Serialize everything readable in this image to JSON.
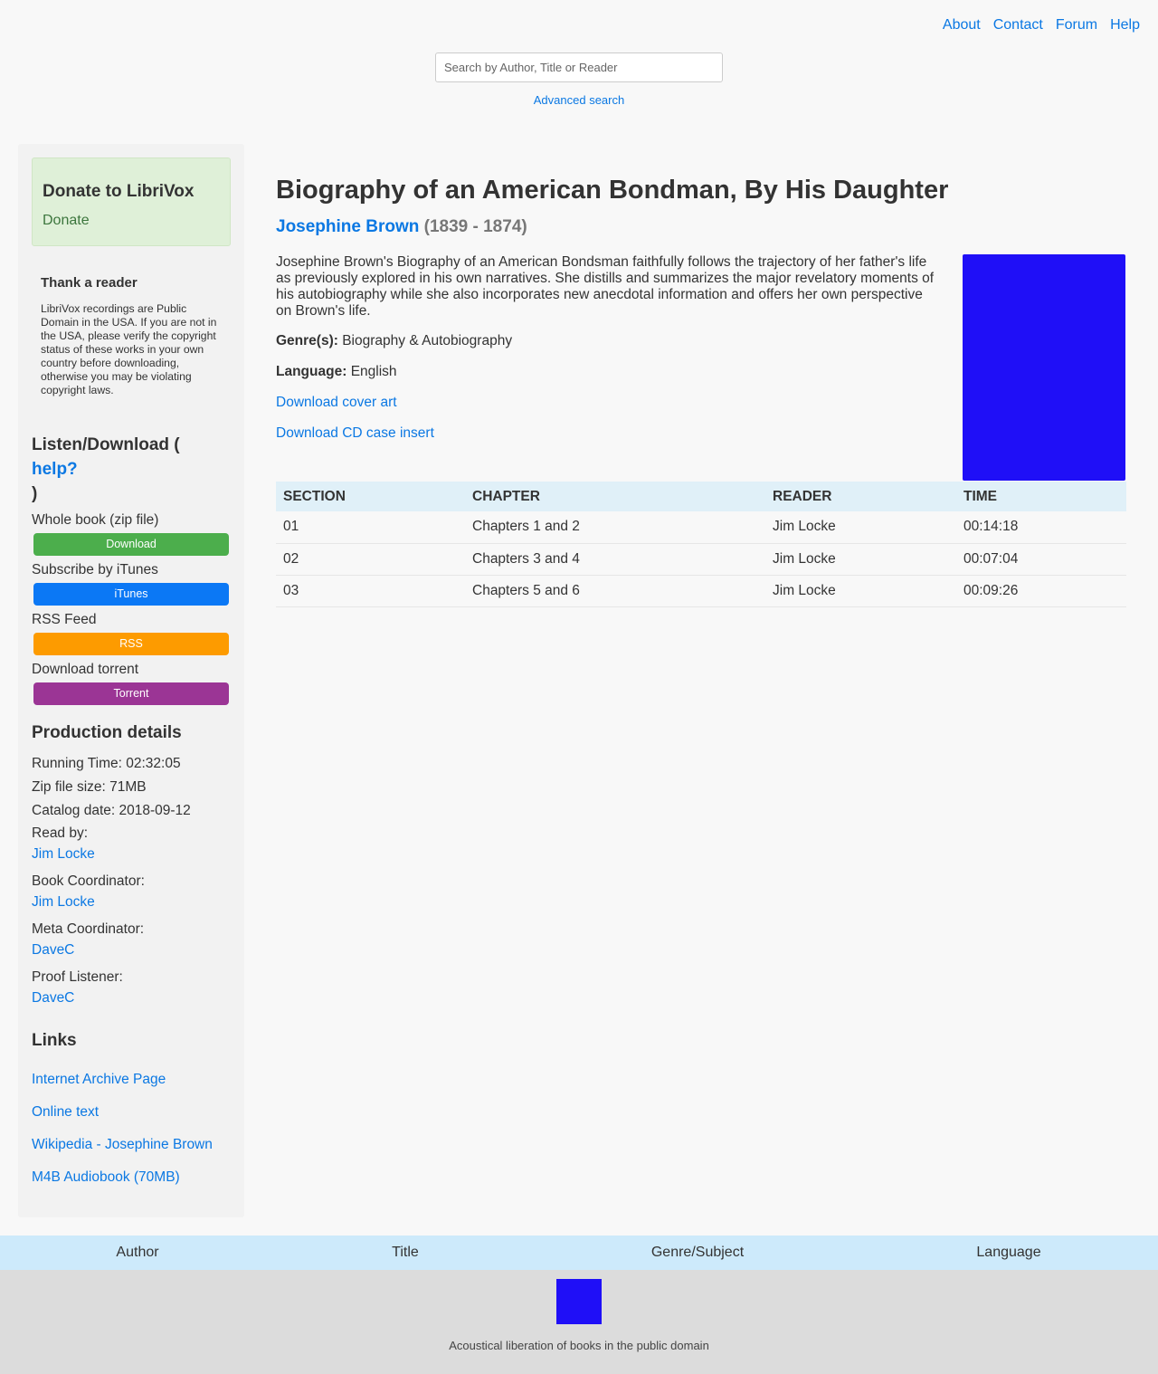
{
  "nav": {
    "about": "About",
    "contact": "Contact",
    "forum": "Forum",
    "help": "Help"
  },
  "search": {
    "placeholder": "Search by Author, Title or Reader",
    "advanced": "Advanced search"
  },
  "sidebar": {
    "donate_title": "Donate to LibriVox",
    "donate_link": "Donate",
    "thank_title": "Thank a reader",
    "thank_text": "LibriVox recordings are Public Domain in the USA. If you are not in the USA, please verify the copyright status of these works in your own country before downloading, otherwise you may be violating copyright laws.",
    "listen_title_pre": "Listen/Download (",
    "listen_help": "help?",
    "listen_title_post": ")",
    "downloads": [
      {
        "label": "Whole book (zip file)",
        "button": "Download",
        "color": "#4cae4c"
      },
      {
        "label": "Subscribe by iTunes",
        "button": "iTunes",
        "color": "#0b78f5"
      },
      {
        "label": "RSS Feed",
        "button": "RSS",
        "color": "#fd9b00"
      },
      {
        "label": "Download torrent",
        "button": "Torrent",
        "color": "#9b3595"
      }
    ],
    "production": {
      "title": "Production details",
      "running_time": "Running Time: 02:32:05",
      "zip_size": "Zip file size: 71MB",
      "catalog_date": "Catalog date: 2018-09-12",
      "read_by_label": "Read by:",
      "read_by": "Jim Locke",
      "book_coord_label": "Book Coordinator:",
      "book_coord": "Jim Locke",
      "meta_coord_label": "Meta Coordinator:",
      "meta_coord": "DaveC",
      "proof_label": "Proof Listener:",
      "proof": "DaveC"
    },
    "links": {
      "title": "Links",
      "items": [
        "Internet Archive Page",
        "Online text",
        "Wikipedia - Josephine Brown",
        "M4B Audiobook (70MB)"
      ]
    }
  },
  "book": {
    "title": "Biography of an American Bondman, By His Daughter",
    "author": "Josephine Brown",
    "dates": "(1839 - 1874)",
    "description": "Josephine Brown's Biography of an American Bondsman faithfully follows the trajectory of her father's life as previously explored in his own narratives. She distills and summarizes the major revelatory moments of his autobiography while she also incorporates new anecdotal information and offers her own perspective on Brown's life.",
    "genre_label": "Genre(s):",
    "genre": "Biography & Autobiography",
    "language_label": "Language:",
    "language": "English",
    "cover_link": "Download cover art",
    "cd_link": "Download CD case insert",
    "cover_color": "#1f0ff7"
  },
  "sections": {
    "headers": [
      "SECTION",
      "CHAPTER",
      "READER",
      "TIME"
    ],
    "rows": [
      [
        "01",
        "Chapters 1 and 2",
        "Jim Locke",
        "00:14:18"
      ],
      [
        "02",
        "Chapters 3 and 4",
        "Jim Locke",
        "00:07:04"
      ],
      [
        "03",
        "Chapters 5 and 6",
        "Jim Locke",
        "00:09:26"
      ]
    ]
  },
  "browse": {
    "author": "Author",
    "title": "Title",
    "genre": "Genre/Subject",
    "language": "Language"
  },
  "footer": {
    "tagline": "Acoustical liberation of books in the public domain"
  }
}
